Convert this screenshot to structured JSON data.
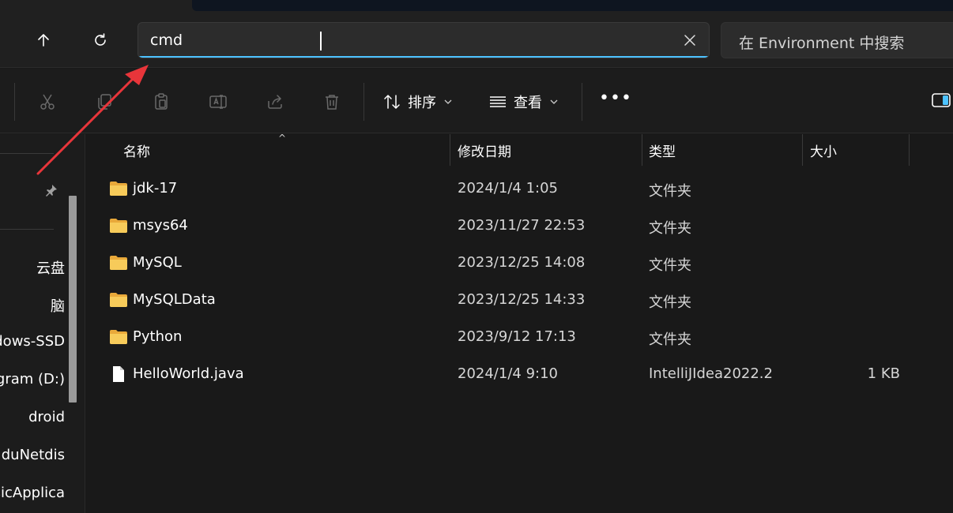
{
  "window": {
    "address_value": "cmd",
    "search_placeholder": "在 Environment 中搜索"
  },
  "nav_buttons": {
    "up_icon": "arrow-up-icon",
    "refresh_icon": "refresh-icon",
    "clear_icon": "close-icon"
  },
  "toolbar": {
    "sort_label": "排序",
    "view_label": "查看",
    "more_label": "•••",
    "icons": [
      "cut-icon",
      "copy-icon",
      "paste-icon",
      "rename-icon",
      "share-icon",
      "delete-icon",
      "sort-icon",
      "view-icon",
      "details-pane-icon"
    ]
  },
  "nav_pane": {
    "items": [
      {
        "label": "云盘"
      },
      {
        "label": "脑"
      },
      {
        "label": "dows-SSD"
      },
      {
        "label": "gram (D:)"
      },
      {
        "label": "droid"
      },
      {
        "label": "duNetdis"
      },
      {
        "label": "sicApplica"
      }
    ]
  },
  "columns": {
    "name": "名称",
    "date": "修改日期",
    "type": "类型",
    "size": "大小"
  },
  "files": [
    {
      "name": "jdk-17",
      "date": "2024/1/4 1:05",
      "type": "文件夹",
      "size": "",
      "icon": "folder-icon"
    },
    {
      "name": "msys64",
      "date": "2023/11/27 22:53",
      "type": "文件夹",
      "size": "",
      "icon": "folder-icon"
    },
    {
      "name": "MySQL",
      "date": "2023/12/25 14:08",
      "type": "文件夹",
      "size": "",
      "icon": "folder-icon"
    },
    {
      "name": "MySQLData",
      "date": "2023/12/25 14:33",
      "type": "文件夹",
      "size": "",
      "icon": "folder-icon"
    },
    {
      "name": "Python",
      "date": "2023/9/12 17:13",
      "type": "文件夹",
      "size": "",
      "icon": "folder-icon"
    },
    {
      "name": "HelloWorld.java",
      "date": "2024/1/4 9:10",
      "type": "IntelliJIdea2022.2",
      "size": "1 KB",
      "icon": "file-icon"
    }
  ],
  "colors": {
    "accent": "#4cc2ff",
    "folder": "#f3c14b",
    "annotation_arrow": "#e8353a"
  }
}
